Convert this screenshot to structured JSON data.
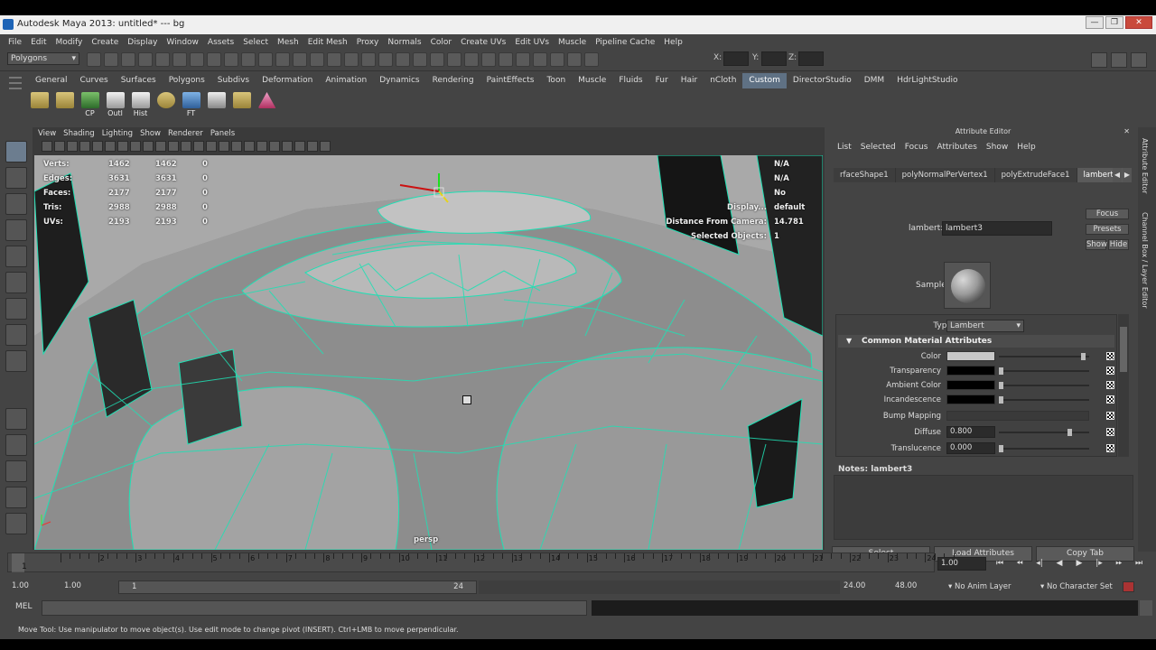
{
  "window": {
    "title": "Autodesk Maya 2013: untitled*   ---   bg",
    "controls": [
      "—",
      "❐",
      "✕"
    ]
  },
  "menubar": [
    "File",
    "Edit",
    "Modify",
    "Create",
    "Display",
    "Window",
    "Assets",
    "Select",
    "Mesh",
    "Edit Mesh",
    "Proxy",
    "Normals",
    "Color",
    "Create UVs",
    "Edit UVs",
    "Muscle",
    "Pipeline Cache",
    "Help"
  ],
  "statusline": {
    "mode": "Polygons",
    "x_label": "X:",
    "y_label": "Y:",
    "z_label": "Z:"
  },
  "shelf": {
    "tabs": [
      "General",
      "Curves",
      "Surfaces",
      "Polygons",
      "Subdivs",
      "Deformation",
      "Animation",
      "Dynamics",
      "Rendering",
      "PaintEffects",
      "Toon",
      "Muscle",
      "Fluids",
      "Fur",
      "Hair",
      "nCloth",
      "Custom",
      "DirectorStudio",
      "DMM",
      "HdrLightStudio"
    ],
    "active_tab": "Custom",
    "icons": [
      {
        "label": "",
        "icon": "polygon-tool-icon"
      },
      {
        "label": "",
        "icon": "bevel-icon"
      },
      {
        "label": "CP",
        "icon": "center-pivot-icon"
      },
      {
        "label": "Outl",
        "icon": "outliner-icon"
      },
      {
        "label": "Hist",
        "icon": "history-icon"
      },
      {
        "label": "",
        "icon": "sphere-wire-icon"
      },
      {
        "label": "FT",
        "icon": "freeze-transform-icon"
      },
      {
        "label": "",
        "icon": "joint-icon"
      },
      {
        "label": "",
        "icon": "duplicate-icon"
      },
      {
        "label": "",
        "icon": "cone-icon"
      }
    ]
  },
  "viewport": {
    "menu": [
      "View",
      "Shading",
      "Lighting",
      "Show",
      "Renderer",
      "Panels"
    ],
    "camera": "persp",
    "hud_left": [
      {
        "label": "Verts:",
        "a": "1462",
        "b": "1462",
        "c": "0"
      },
      {
        "label": "Edges:",
        "a": "3631",
        "b": "3631",
        "c": "0"
      },
      {
        "label": "Faces:",
        "a": "2177",
        "b": "2177",
        "c": "0"
      },
      {
        "label": "Tris:",
        "a": "2988",
        "b": "2988",
        "c": "0"
      },
      {
        "label": "UVs:",
        "a": "2193",
        "b": "2193",
        "c": "0"
      }
    ],
    "hud_right": [
      {
        "label": "",
        "value": "N/A"
      },
      {
        "label": "",
        "value": "N/A"
      },
      {
        "label": "",
        "value": "No"
      },
      {
        "label": "Display...",
        "value": "default"
      },
      {
        "label": "Distance From Camera:",
        "value": "14.781"
      },
      {
        "label": "Selected Objects:",
        "value": "1"
      }
    ]
  },
  "attribute_editor": {
    "title": "Attribute Editor",
    "menu": [
      "List",
      "Selected",
      "Focus",
      "Attributes",
      "Show",
      "Help"
    ],
    "tabs": [
      "rfaceShape1",
      "polyNormalPerVertex1",
      "polyExtrudeFace1",
      "lambert3"
    ],
    "active_tab": "lambert3",
    "node_label": "lambert:",
    "node_name": "lambert3",
    "buttons": {
      "focus": "Focus",
      "presets": "Presets",
      "show": "Show",
      "hide": "Hide"
    },
    "sample_label": "Sample",
    "type_label": "Type",
    "type_value": "Lambert",
    "section": "Common Material Attributes",
    "attributes": [
      {
        "label": "Color",
        "kind": "swatch",
        "color": "#c8c8c8",
        "slider": 0.96
      },
      {
        "label": "Transparency",
        "kind": "swatch",
        "color": "#000000",
        "slider": 0.0
      },
      {
        "label": "Ambient Color",
        "kind": "swatch",
        "color": "#000000",
        "slider": 0.0
      },
      {
        "label": "Incandescence",
        "kind": "swatch",
        "color": "#000000",
        "slider": 0.0
      },
      {
        "label": "Bump Mapping",
        "kind": "map",
        "value": ""
      },
      {
        "label": "Diffuse",
        "kind": "number",
        "value": "0.800",
        "slider": 0.8
      },
      {
        "label": "Translucence",
        "kind": "number",
        "value": "0.000",
        "slider": 0.0
      }
    ],
    "notes_label": "Notes: lambert3",
    "bottom_buttons": [
      "Select",
      "Load Attributes",
      "Copy Tab"
    ],
    "side_tabs": [
      "Attribute Editor",
      "Channel Box / Layer Editor"
    ]
  },
  "timeslider": {
    "ticks": [
      "1",
      "2",
      "3",
      "4",
      "5",
      "6",
      "7",
      "8",
      "9",
      "10",
      "11",
      "12",
      "13",
      "14",
      "15",
      "16",
      "17",
      "18",
      "19",
      "20",
      "21",
      "22",
      "23",
      "24"
    ],
    "current_frame_label": "1",
    "frame_field": "1.00",
    "playback": [
      "⏮",
      "⏪︎",
      "◂|",
      "◀",
      "▶",
      "|▸",
      "⏩︎",
      "⏭"
    ]
  },
  "range": {
    "start": "1.00",
    "start2": "1.00",
    "bar_start": "1",
    "bar_end": "24",
    "end": "24.00",
    "end2": "48.00",
    "anim_layer": "No Anim Layer",
    "character_set": "No Character Set"
  },
  "commandline": {
    "label": "MEL"
  },
  "helpline": "Move Tool: Use manipulator to move object(s). Use edit mode to change pivot (INSERT).  Ctrl+LMB to move perpendicular."
}
